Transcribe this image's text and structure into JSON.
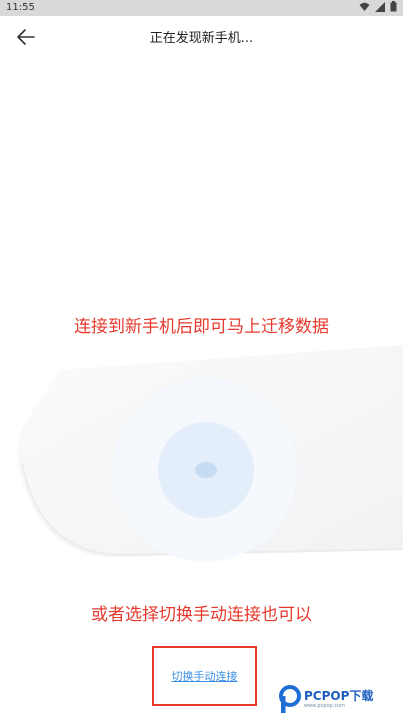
{
  "status_bar": {
    "time": "11:55"
  },
  "header": {
    "title": "正在发现新手机..."
  },
  "main": {
    "hint_connect": "连接到新手机后即可马上迁移数据",
    "hint_manual": "或者选择切换手动连接也可以",
    "manual_link_label": "切换手动连接"
  },
  "watermark": {
    "brand": "PCPOP下载",
    "sub": "www.pcpop.com"
  },
  "colors": {
    "accent_red": "#e53a2d",
    "link_blue": "#3b8fe4"
  }
}
